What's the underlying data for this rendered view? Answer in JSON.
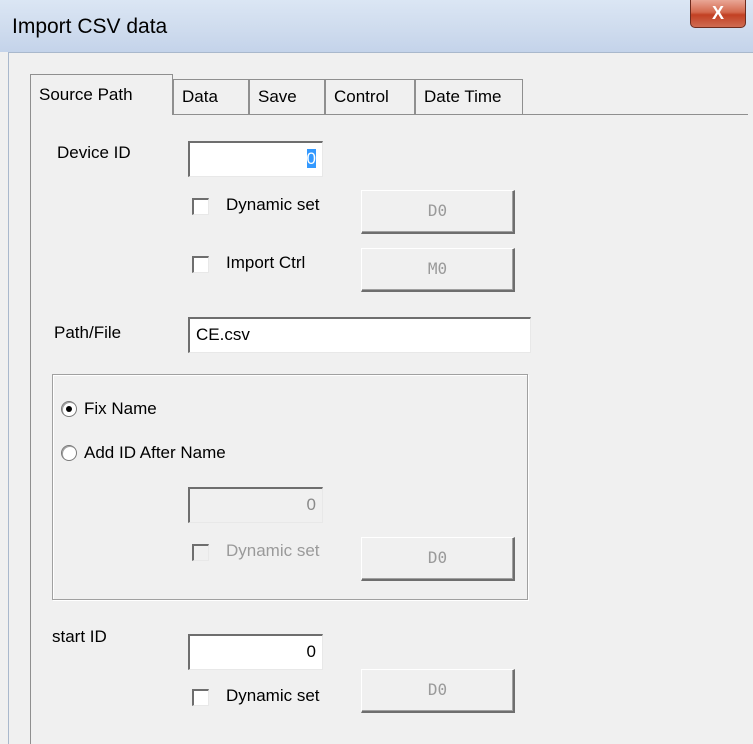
{
  "window": {
    "title": "Import CSV data",
    "close_glyph": "X"
  },
  "tabs": [
    {
      "label": "Source Path",
      "active": true
    },
    {
      "label": "Data",
      "active": false
    },
    {
      "label": "Save",
      "active": false
    },
    {
      "label": "Control",
      "active": false
    },
    {
      "label": "Date Time",
      "active": false
    }
  ],
  "device": {
    "label": "Device ID",
    "value": "0",
    "dynamic_label": "Dynamic set",
    "dynamic_checked": false,
    "dynamic_button": "D0",
    "import_ctrl_label": "Import Ctrl",
    "import_ctrl_checked": false,
    "import_ctrl_button": "M0"
  },
  "path": {
    "label": "Path/File",
    "value": "CE.csv"
  },
  "naming": {
    "fix_name_label": "Fix Name",
    "fix_name_selected": true,
    "add_id_label": "Add ID After Name",
    "add_id_selected": false,
    "id_value": "0",
    "dynamic_label": "Dynamic set",
    "dynamic_checked": false,
    "dynamic_button": "D0"
  },
  "start": {
    "label": "start ID",
    "value": "0",
    "dynamic_label": "Dynamic set",
    "dynamic_checked": false,
    "dynamic_button": "D0"
  }
}
